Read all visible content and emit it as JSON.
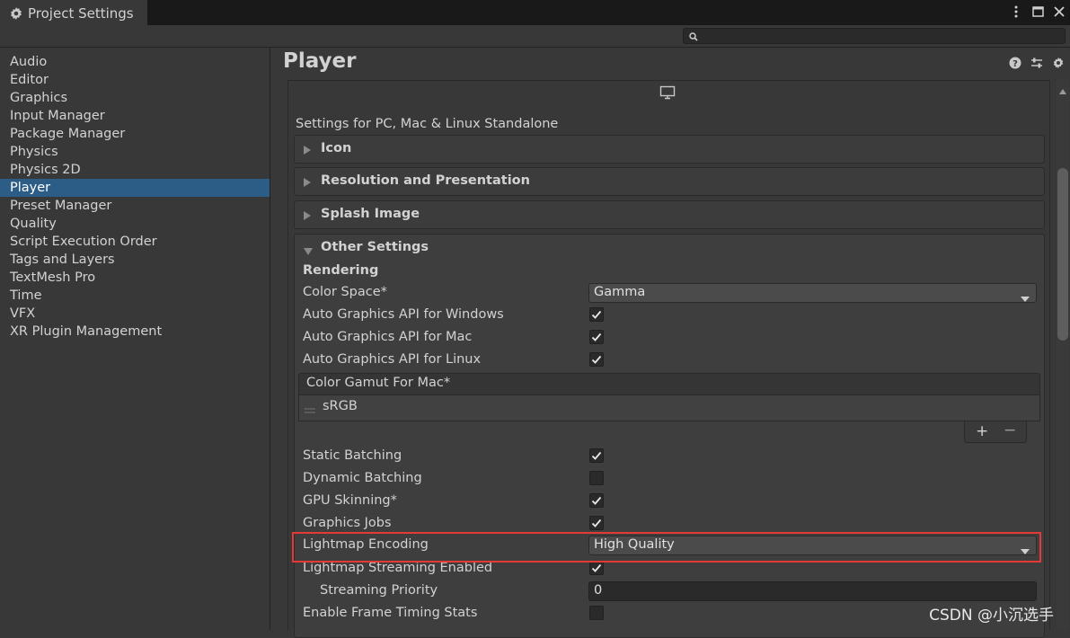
{
  "window": {
    "tab_title": "Project Settings"
  },
  "search": {
    "placeholder": ""
  },
  "sidebar": {
    "items": [
      {
        "label": "Audio"
      },
      {
        "label": "Editor"
      },
      {
        "label": "Graphics"
      },
      {
        "label": "Input Manager"
      },
      {
        "label": "Package Manager"
      },
      {
        "label": "Physics"
      },
      {
        "label": "Physics 2D"
      },
      {
        "label": "Player"
      },
      {
        "label": "Preset Manager"
      },
      {
        "label": "Quality"
      },
      {
        "label": "Script Execution Order"
      },
      {
        "label": "Tags and Layers"
      },
      {
        "label": "TextMesh Pro"
      },
      {
        "label": "Time"
      },
      {
        "label": "VFX"
      },
      {
        "label": "XR Plugin Management"
      }
    ],
    "active_index": 7,
    "active_color": "#2c5d87"
  },
  "main": {
    "title": "Player",
    "subtitle": "Settings for PC, Mac & Linux Standalone",
    "foldouts": [
      "Icon",
      "Resolution and Presentation",
      "Splash Image"
    ],
    "other_settings": {
      "label": "Other Settings",
      "section": "Rendering",
      "color_space": {
        "label": "Color Space*",
        "value": "Gamma"
      },
      "api_rows": [
        {
          "label": "Auto Graphics API  for Windows",
          "checked": true
        },
        {
          "label": "Auto Graphics API  for Mac",
          "checked": true
        },
        {
          "label": "Auto Graphics API  for Linux",
          "checked": true
        }
      ],
      "gamut": {
        "label": "Color Gamut For Mac*",
        "items": [
          "sRGB"
        ],
        "add": "+",
        "remove": "−"
      },
      "rows": [
        {
          "label": "Static Batching",
          "checked": true
        },
        {
          "label": "Dynamic Batching",
          "checked": false
        },
        {
          "label": "GPU Skinning*",
          "checked": true
        },
        {
          "label": "Graphics Jobs",
          "checked": true
        }
      ],
      "lightmap_encoding": {
        "label": "Lightmap Encoding",
        "value": "High Quality"
      },
      "lightmap_streaming": {
        "label": "Lightmap Streaming Enabled",
        "checked": true
      },
      "streaming_priority": {
        "label": "Streaming Priority",
        "value": "0"
      },
      "frame_timing": {
        "label": "Enable Frame Timing Stats",
        "checked": false
      }
    }
  },
  "highlight_color": "#e53935",
  "watermark": "CSDN @小沉选手"
}
